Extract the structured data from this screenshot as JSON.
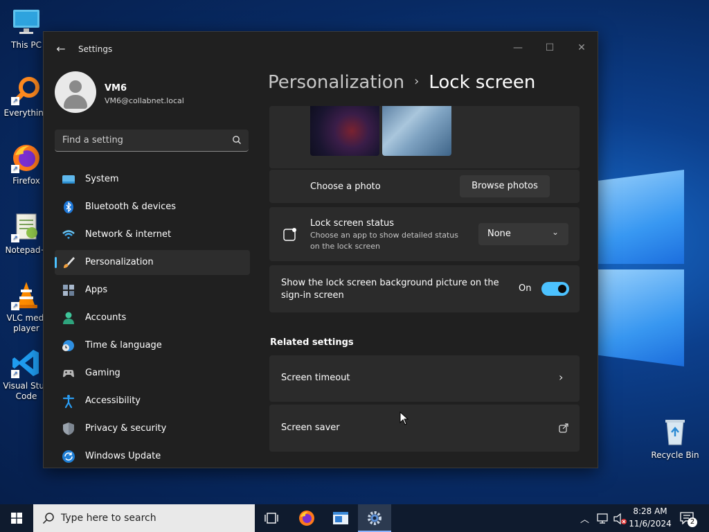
{
  "desktop": {
    "icons": [
      {
        "label": "This PC"
      },
      {
        "label": "Everything"
      },
      {
        "label": "Firefox"
      },
      {
        "label": "Notepad+"
      },
      {
        "label": "VLC medi\nplayer"
      },
      {
        "label": "Visual Stud\nCode"
      },
      {
        "label": "Recycle Bin"
      }
    ]
  },
  "window": {
    "title": "Settings",
    "profile": {
      "name": "VM6",
      "email": "VM6@collabnet.local"
    },
    "search": {
      "placeholder": "Find a setting"
    },
    "nav": [
      {
        "label": "System"
      },
      {
        "label": "Bluetooth & devices"
      },
      {
        "label": "Network & internet"
      },
      {
        "label": "Personalization"
      },
      {
        "label": "Apps"
      },
      {
        "label": "Accounts"
      },
      {
        "label": "Time & language"
      },
      {
        "label": "Gaming"
      },
      {
        "label": "Accessibility"
      },
      {
        "label": "Privacy & security"
      },
      {
        "label": "Windows Update"
      }
    ],
    "breadcrumb": {
      "parent": "Personalization",
      "current": "Lock screen"
    },
    "content": {
      "choose_photo": {
        "label": "Choose a photo",
        "button": "Browse photos"
      },
      "status": {
        "label": "Lock screen status",
        "description": "Choose an app to show detailed status on the lock screen",
        "value": "None"
      },
      "signin": {
        "label": "Show the lock screen background picture on the sign-in screen",
        "state": "On"
      },
      "related_title": "Related settings",
      "related": [
        {
          "label": "Screen timeout"
        },
        {
          "label": "Screen saver"
        }
      ]
    }
  },
  "taskbar": {
    "search_placeholder": "Type here to search",
    "time": "8:28 AM",
    "date": "11/6/2024",
    "notification_count": "2"
  },
  "colors": {
    "accent": "#4cc2ff"
  }
}
